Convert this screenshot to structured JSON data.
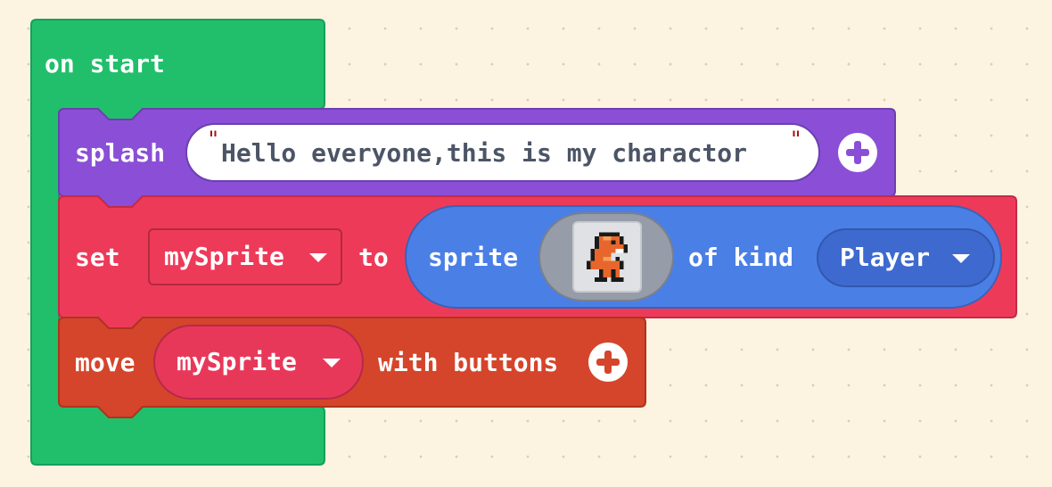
{
  "workspace": {
    "background": "#fdf3e1",
    "dot_color": "#d9cdb8"
  },
  "on_start": {
    "label": "on start",
    "color": "#21bf6b"
  },
  "splash": {
    "label": "splash",
    "open_quote": "\"",
    "text": "Hello everyone,this is my charactor",
    "close_quote": "\"",
    "add_icon": "plus-circle-icon",
    "color": "#8a4fd6"
  },
  "set_sprite": {
    "label_set": "set",
    "variable": "mySprite",
    "label_to": "to",
    "label_sprite": "sprite",
    "image_icon": "orange-dinosaur-pixel-sprite",
    "label_of_kind": "of kind",
    "kind": "Player",
    "color": "#ee3a59",
    "sprite_color": "#4a7fe6"
  },
  "move": {
    "label_move": "move",
    "variable": "mySprite",
    "label_with_buttons": "with buttons",
    "add_icon": "plus-circle-icon",
    "color": "#d5452b"
  }
}
